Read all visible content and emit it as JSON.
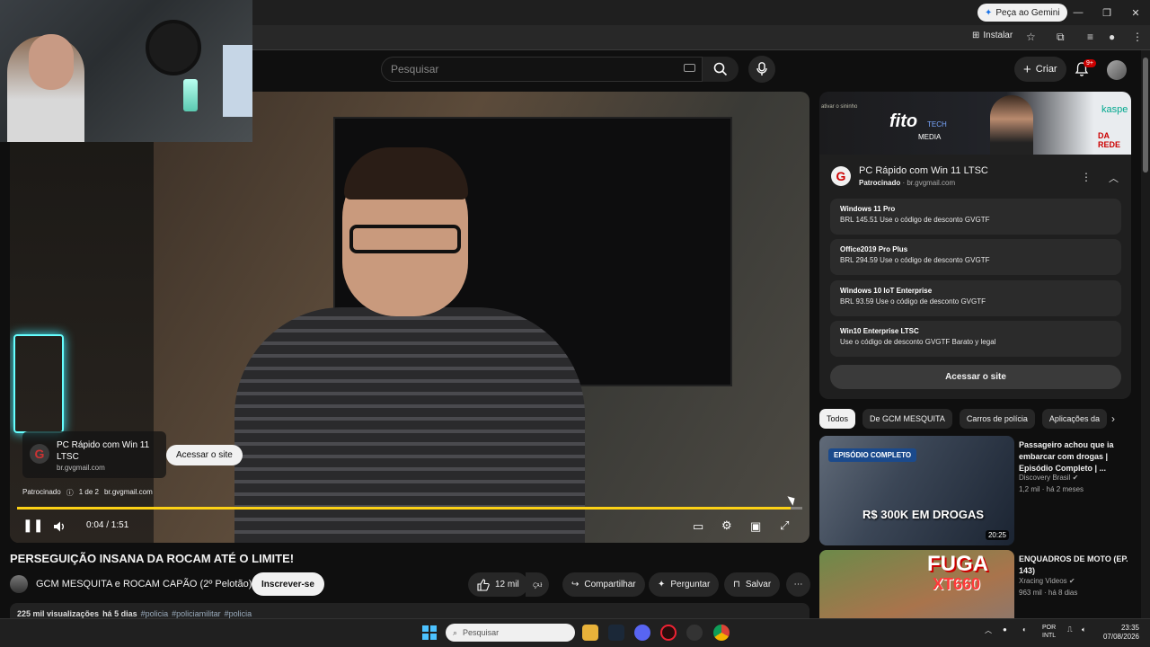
{
  "browser": {
    "gemini_btn": "Peça ao Gemini",
    "install_btn": "Instalar"
  },
  "header": {
    "search_placeholder": "Pesquisar",
    "create_label": "Criar",
    "notif_count": "9+"
  },
  "player": {
    "ad": {
      "title": "PC Rápido com Win 11 LTSC",
      "url": "br.gvgmail.com",
      "visit_label": "Acessar o site",
      "sponsored": "Patrocinado",
      "position": "1 de 2",
      "meta_url": "br.gvgmail.com"
    },
    "time": "0:04 / 1:51",
    "progress": 0.985
  },
  "video": {
    "title": "PERSEGUIÇÃO INSANA DA ROCAM ATÉ O LIMITE!",
    "channel": "GCM MESQUITA e ROCAM CAPÃO (2º Pelotão)",
    "subscribe": "Inscrever-se",
    "likes": "12 mil",
    "share": "Compartilhar",
    "ask": "Perguntar",
    "save": "Salvar",
    "views": "225 mil visualizações",
    "age": "há 5 dias",
    "tags": [
      "#policia",
      "#policiamilitar",
      "#policia"
    ]
  },
  "banner": {
    "left_text": "ativar o sininho",
    "fito": "fito",
    "tech": "TECH",
    "media": "MEDIA",
    "kasp": "kaspe",
    "red": "DA REDE"
  },
  "sponsor": {
    "title": "PC Rápido com Win 11 LTSC",
    "sponsored": "Patrocinado",
    "url": "br.gvgmail.com",
    "visit": "Acessar o site",
    "items": [
      {
        "name": "Windows 11 Pro",
        "detail": "BRL 145.51 Use o código de desconto GVGTF"
      },
      {
        "name": "Office2019 Pro Plus",
        "detail": "BRL 294.59 Use o código de desconto GVGTF"
      },
      {
        "name": "Windows 10 IoT Enterprise",
        "detail": "BRL 93.59 Use o código de desconto GVGTF"
      },
      {
        "name": "Win10 Enterprise LTSC",
        "detail": "Use o código de desconto GVGTF Barato y legal"
      }
    ]
  },
  "chips": [
    "Todos",
    "De GCM MESQUITA",
    "Carros de polícia",
    "Aplicações da"
  ],
  "recommendations": [
    {
      "title": "Passageiro achou que ia embarcar com drogas | Episódio Completo | ...",
      "channel": "Discovery Brasil",
      "views": "1,2 mil",
      "age": "há 2 meses",
      "badge": "EPISÓDIO COMPLETO",
      "overlay": "R$ 300K EM DROGAS",
      "duration": "20:25"
    },
    {
      "title": "ENQUADROS DE MOTO (EP. 143)",
      "channel": "Xracing Videos",
      "views": "963 mil",
      "age": "há 8 dias",
      "overlay1": "FUGA",
      "overlay2": "XT660"
    }
  ],
  "taskbar": {
    "search": "Pesquisar",
    "lang1": "POR",
    "lang2": "INTL",
    "time": "23:35",
    "date": "07/08/2026"
  }
}
